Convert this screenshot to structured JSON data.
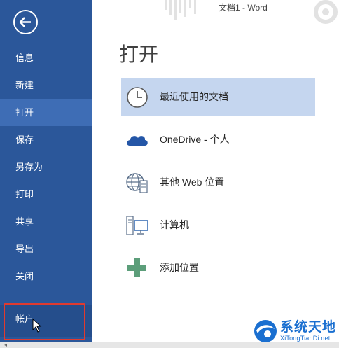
{
  "window": {
    "title": "文档1 - Word"
  },
  "sidebar": {
    "back_icon": "back-arrow-icon",
    "items": [
      {
        "label": "信息"
      },
      {
        "label": "新建"
      },
      {
        "label": "打开"
      },
      {
        "label": "保存"
      },
      {
        "label": "另存为"
      },
      {
        "label": "打印"
      },
      {
        "label": "共享"
      },
      {
        "label": "导出"
      },
      {
        "label": "关闭"
      }
    ],
    "active_item": "打开",
    "account": {
      "label": "帐户"
    }
  },
  "main": {
    "title": "打开",
    "options": [
      {
        "label": "最近使用的文档",
        "icon": "clock-icon",
        "selected": true
      },
      {
        "label": "OneDrive - 个人",
        "icon": "cloud-icon",
        "selected": false
      },
      {
        "label": "其他 Web 位置",
        "icon": "globe-icon",
        "selected": false
      },
      {
        "label": "计算机",
        "icon": "computer-icon",
        "selected": false
      },
      {
        "label": "添加位置",
        "icon": "plus-icon",
        "selected": false
      }
    ]
  },
  "watermark": {
    "text": "系统天地",
    "url": "XiTongTianDi.net"
  },
  "colors": {
    "sidebar": "#2b579a",
    "sidebar_active": "#3e6db5",
    "selected_option": "#c5d6ef",
    "highlight_box": "#e03a2f",
    "plus": "#5c9e7a"
  }
}
